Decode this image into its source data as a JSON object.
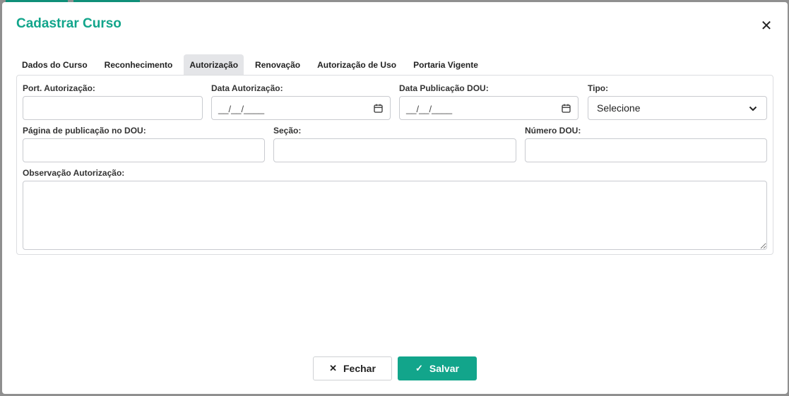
{
  "modal": {
    "title": "Cadastrar Curso",
    "close_glyph": "✕"
  },
  "tabs": [
    {
      "label": "Dados do Curso",
      "active": false
    },
    {
      "label": "Reconhecimento",
      "active": false
    },
    {
      "label": "Autorização",
      "active": true
    },
    {
      "label": "Renovação",
      "active": false
    },
    {
      "label": "Autorização de Uso",
      "active": false
    },
    {
      "label": "Portaria Vigente",
      "active": false
    }
  ],
  "form": {
    "port_autorizacao": {
      "label": "Port. Autorização:",
      "value": ""
    },
    "data_autorizacao": {
      "label": "Data Autorização:",
      "mask": "__/__/____"
    },
    "data_publicacao_dou": {
      "label": "Data Publicação DOU:",
      "mask": "__/__/____"
    },
    "tipo": {
      "label": "Tipo:",
      "selected": "Selecione"
    },
    "pagina_publicacao_dou": {
      "label": "Página de publicação no DOU:",
      "value": ""
    },
    "secao": {
      "label": "Seção:",
      "value": ""
    },
    "numero_dou": {
      "label": "Número DOU:",
      "value": ""
    },
    "observacao_autorizacao": {
      "label": "Observação Autorização:",
      "value": ""
    }
  },
  "footer": {
    "close_label": "Fechar",
    "close_icon": "x-icon",
    "save_label": "Salvar",
    "save_icon": "check-icon"
  },
  "colors": {
    "accent": "#12a58b",
    "active_tab_bg": "#e4e5e8"
  }
}
